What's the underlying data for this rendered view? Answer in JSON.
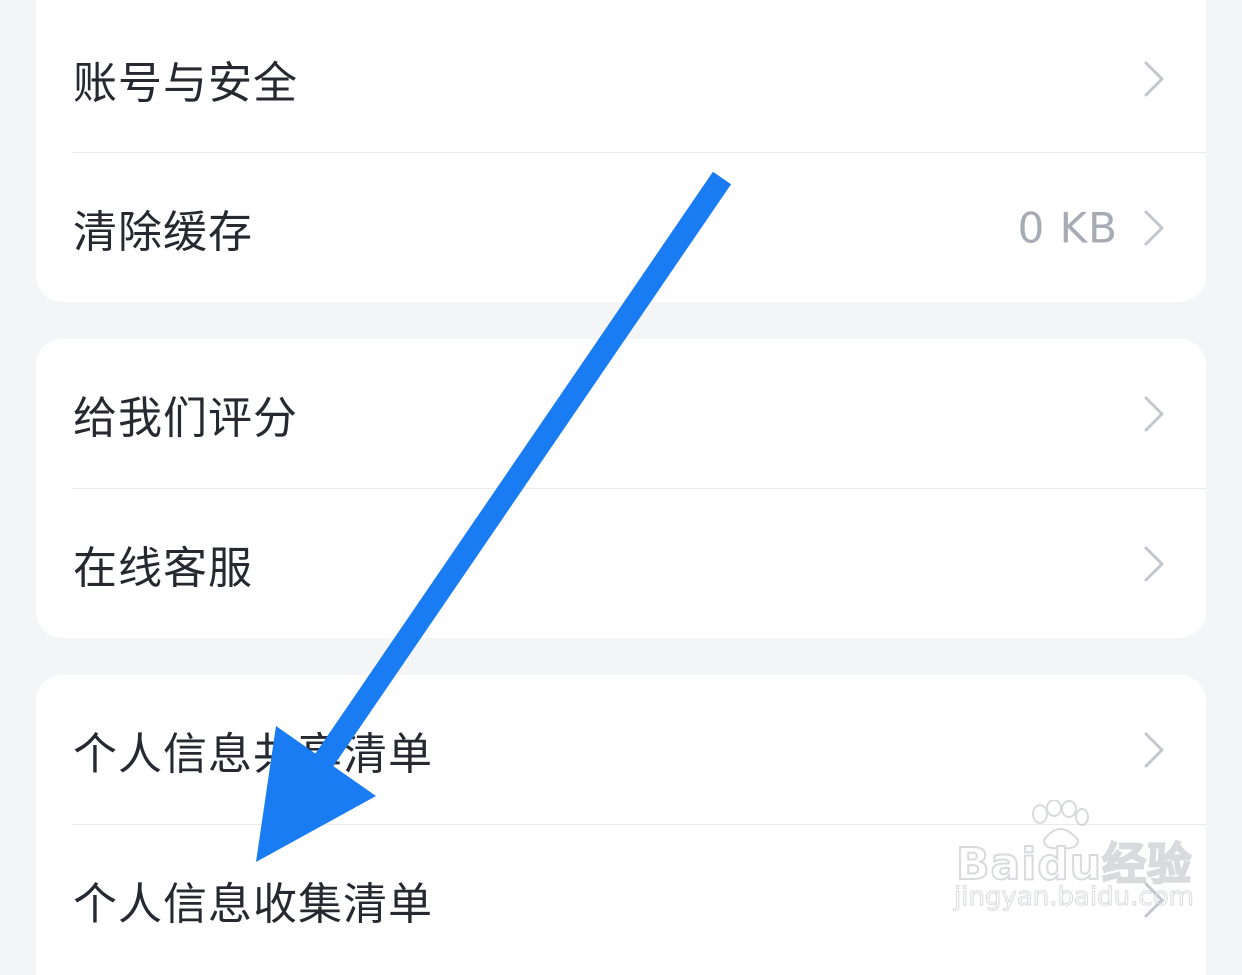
{
  "settings": {
    "group1": [
      {
        "label": "账号与安全",
        "value": ""
      },
      {
        "label": "清除缓存",
        "value": "0 KB"
      }
    ],
    "group2": [
      {
        "label": "给我们评分",
        "value": ""
      },
      {
        "label": "在线客服",
        "value": ""
      }
    ],
    "group3": [
      {
        "label": "个人信息共享清单",
        "value": ""
      },
      {
        "label": "个人信息收集清单",
        "value": ""
      }
    ]
  },
  "annotation": {
    "arrow_color": "#1a7cf2",
    "arrow_icon": "arrow-annotation-icon"
  },
  "watermark": {
    "brand": "Baidu经验",
    "url": "jingyan.baidu.com",
    "icon": "paw-icon"
  },
  "colors": {
    "background": "#f4f5f7",
    "card": "#ffffff",
    "text": "#262a30",
    "secondary_text": "#a7abb3",
    "chevron": "#c3c6cc"
  }
}
